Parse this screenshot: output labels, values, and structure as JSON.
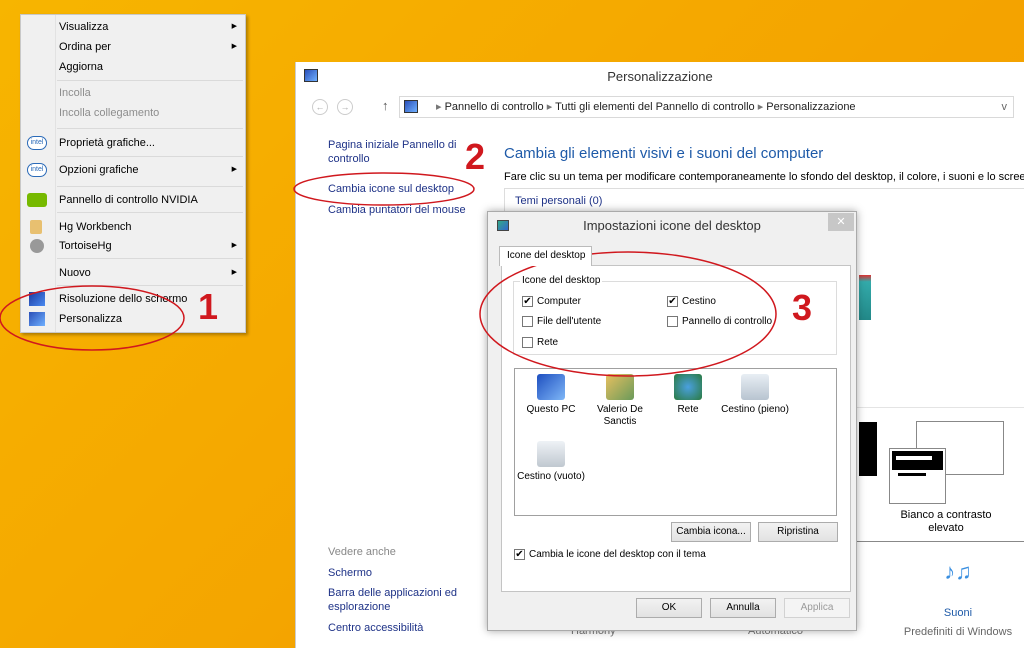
{
  "context_menu": {
    "items": [
      {
        "label": "Visualizza",
        "submenu": true
      },
      {
        "label": "Ordina per",
        "submenu": true
      },
      {
        "label": "Aggiorna"
      },
      {
        "label": "Incolla",
        "disabled": true
      },
      {
        "label": "Incolla collegamento",
        "disabled": true
      },
      {
        "label": "Proprietà grafiche...",
        "icon": "intel-icon",
        "icon_text": "intel"
      },
      {
        "label": "Opzioni grafiche",
        "submenu": true,
        "icon": "intel-icon",
        "icon_text": "intel"
      },
      {
        "label": "Pannello di controllo NVIDIA",
        "icon": "nvidia-icon"
      },
      {
        "label": "Hg Workbench",
        "icon": "hg-workbench-icon"
      },
      {
        "label": "TortoiseHg",
        "submenu": true,
        "icon": "tortoisehg-icon"
      },
      {
        "label": "Nuovo",
        "submenu": true
      },
      {
        "label": "Risoluzione dello schermo",
        "icon": "monitor-icon"
      },
      {
        "label": "Personalizza",
        "icon": "personalize-icon"
      }
    ],
    "arrow": "▶"
  },
  "window": {
    "title": "Personalizzazione",
    "nav": {
      "back": "←",
      "forward": "→",
      "up": "↑",
      "dropdown": "v"
    },
    "breadcrumb": [
      "Pannello di controllo",
      "Tutti gli elementi del Pannello di controllo",
      "Personalizzazione"
    ],
    "crumb_sep": "▸",
    "sidebar": {
      "home": "Pagina iniziale Pannello di controllo",
      "links": [
        "Cambia icone sul desktop",
        "Cambia puntatori del mouse"
      ],
      "see_also_title": "Vedere anche",
      "see_also": [
        "Schermo",
        "Barra delle applicazioni ed esplorazione",
        "Centro accessibilità"
      ]
    },
    "heading": "Cambia gli elementi visivi e i suoni del computer",
    "description": "Fare clic su un tema per modificare contemporaneamente lo sfondo del desktop, il colore, i suoni e lo screen",
    "themes_group": "Temi personali (0)",
    "theme_high_contrast": "Bianco a contrasto elevato",
    "bottom_labels": [
      "Harmony",
      "Automatico"
    ],
    "sounds": {
      "label": "Suoni",
      "sub": "Predefiniti di Windows"
    }
  },
  "dialog": {
    "title": "Impostazioni icone del desktop",
    "close": "✕",
    "tab": "Icone del desktop",
    "group_label": "Icone del desktop",
    "checkboxes": [
      {
        "label": "Computer",
        "checked": true
      },
      {
        "label": "Cestino",
        "checked": true
      },
      {
        "label": "File dell'utente",
        "checked": false
      },
      {
        "label": "Pannello di controllo",
        "checked": false
      },
      {
        "label": "Rete",
        "checked": false
      }
    ],
    "icons": [
      "Questo PC",
      "Valerio De Sanctis",
      "Rete",
      "Cestino (pieno)",
      "Cestino (vuoto)"
    ],
    "change_icon": "Cambia icona...",
    "restore": "Ripristina",
    "theme_checkbox": {
      "label": "Cambia le icone del desktop con il tema",
      "checked": true
    },
    "ok": "OK",
    "cancel": "Annulla",
    "apply": "Applica"
  },
  "annotations": {
    "step1": "1",
    "step2": "2",
    "step3": "3",
    "color": "#d0181e"
  }
}
